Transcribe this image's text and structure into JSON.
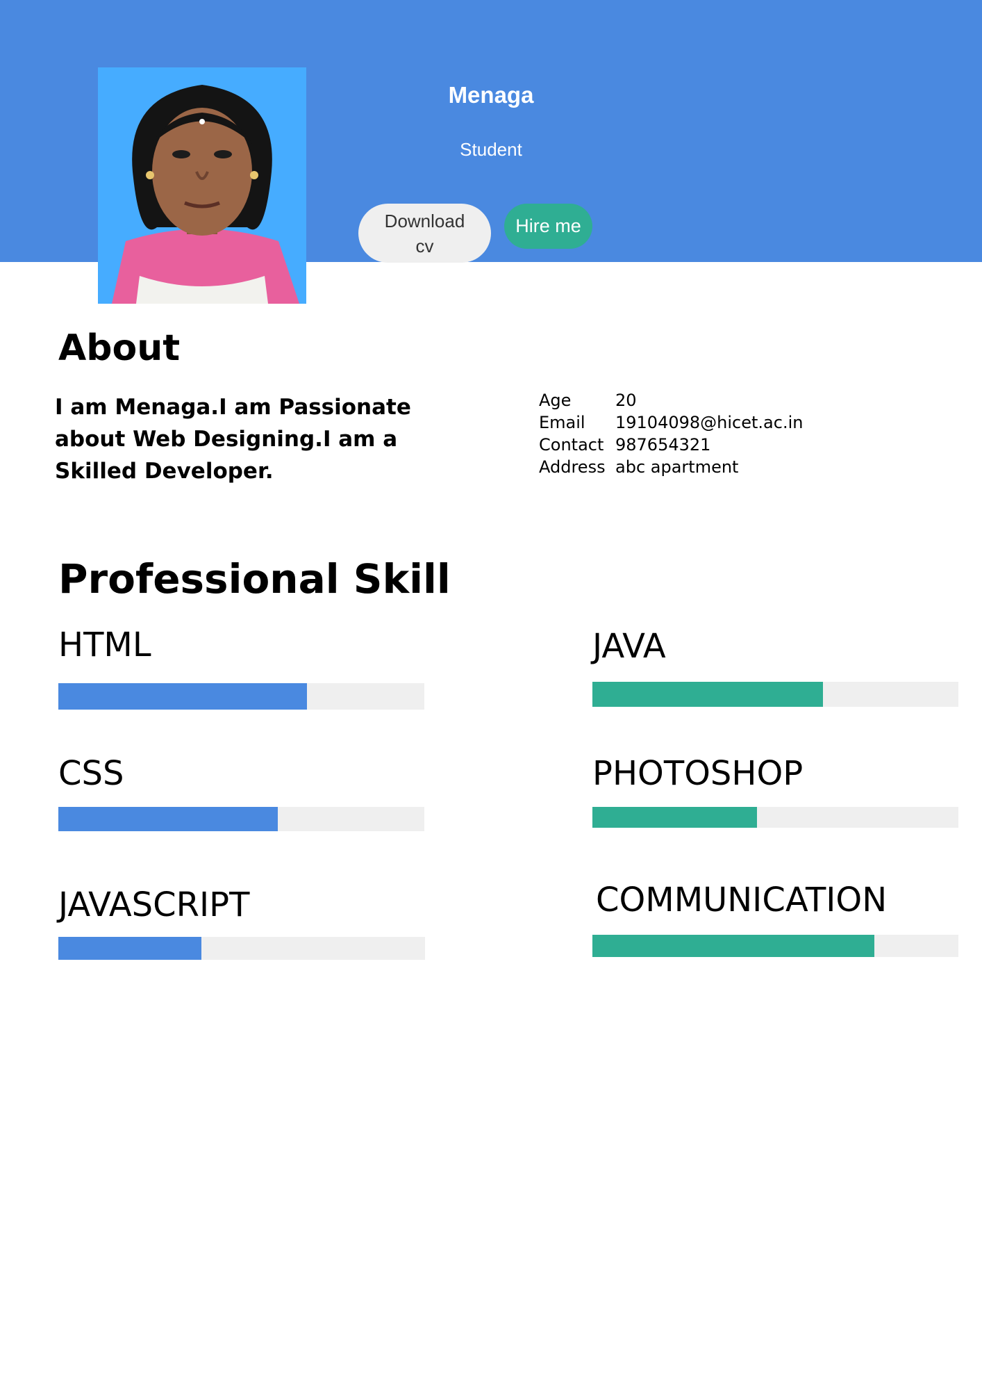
{
  "header": {
    "name": "Menaga",
    "role": "Student",
    "download_label": "Download cv",
    "hire_label": "Hire me",
    "colors": {
      "header_bg": "#4a89e0",
      "accent_green": "#2fae93",
      "photo_bg": "#46acff"
    }
  },
  "about": {
    "title": "About",
    "text": "I am Menaga.I am Passionate about Web Designing.I am a Skilled Developer.",
    "info": [
      {
        "key": "Age",
        "value": "20"
      },
      {
        "key": "Email",
        "value": "19104098@hicet.ac.in"
      },
      {
        "key": "Contact",
        "value": "987654321"
      },
      {
        "key": "Address",
        "value": "abc apartment"
      }
    ]
  },
  "skills": {
    "title": "Professional Skill",
    "items": [
      {
        "name": "HTML",
        "level": 0.68,
        "color": "#4a89e0"
      },
      {
        "name": "CSS",
        "level": 0.6,
        "color": "#4a89e0"
      },
      {
        "name": "JAVASCRIPT",
        "level": 0.39,
        "color": "#4a89e0"
      },
      {
        "name": "JAVA",
        "level": 0.63,
        "color": "#2fae93"
      },
      {
        "name": "PHOTOSHOP",
        "level": 0.45,
        "color": "#2fae93"
      },
      {
        "name": "COMMUNICATION",
        "level": 0.77,
        "color": "#2fae93"
      }
    ]
  }
}
